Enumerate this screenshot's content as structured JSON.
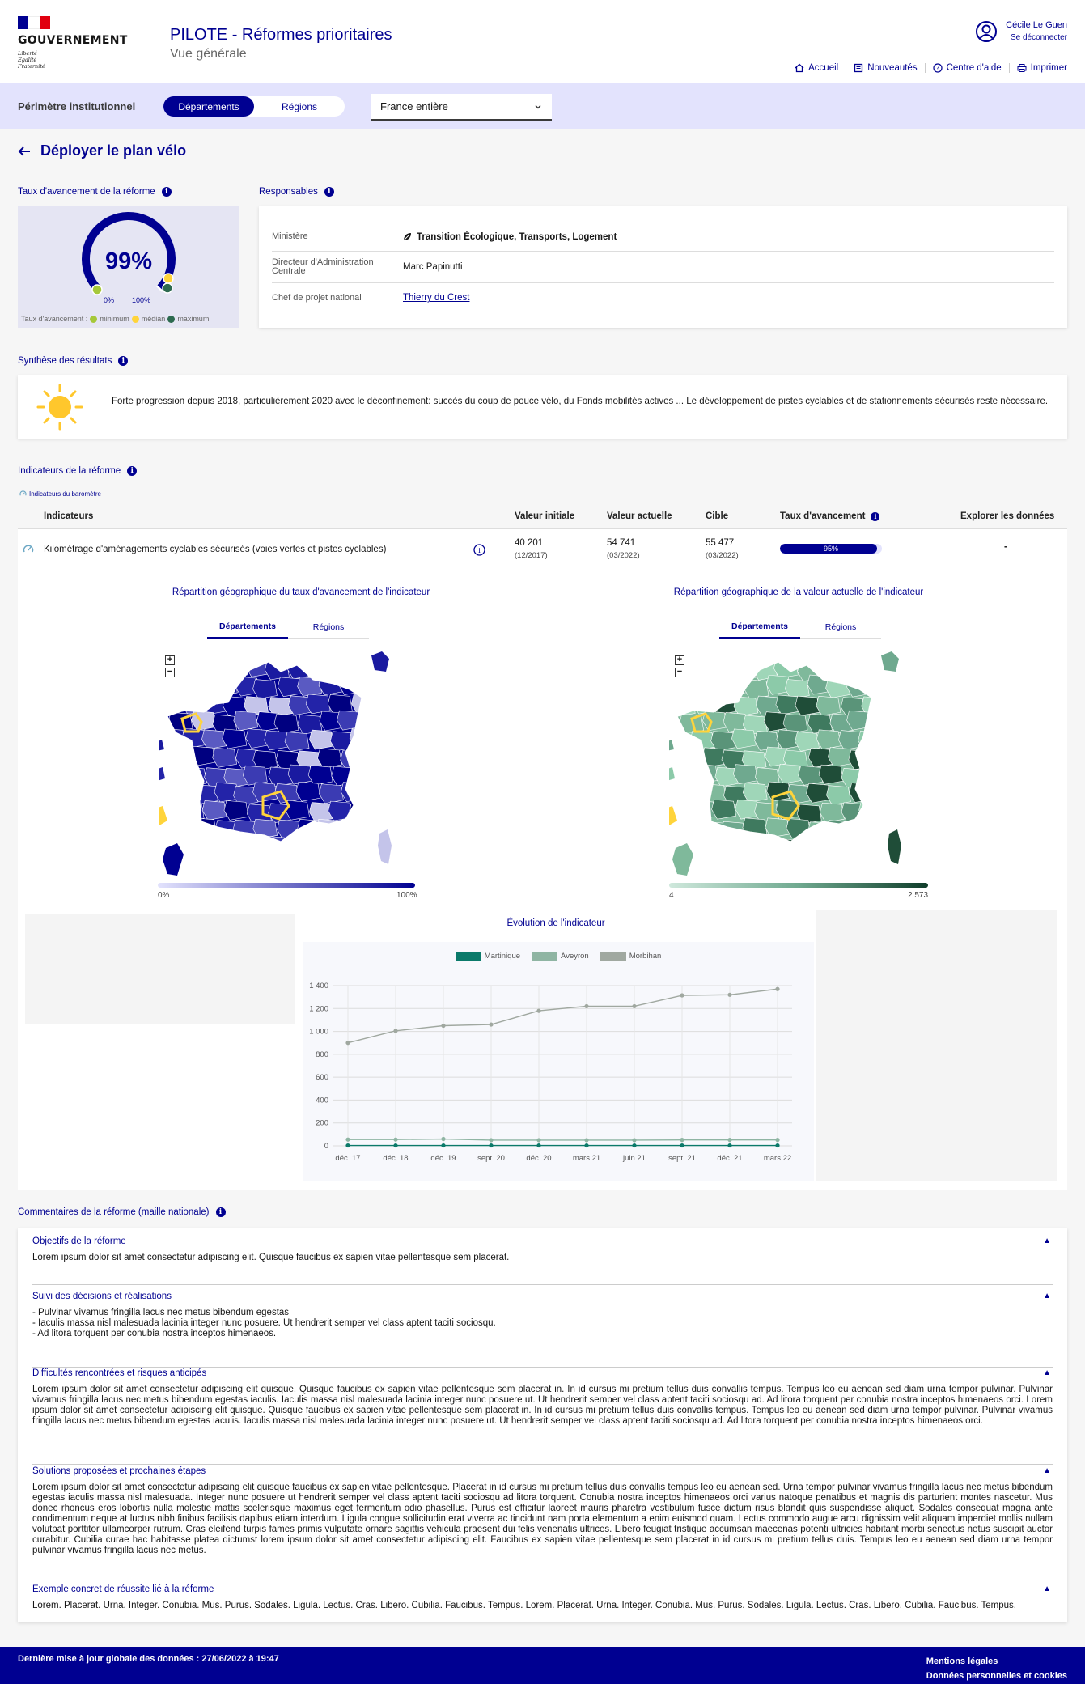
{
  "header": {
    "gov_line": "GOUVERNEMENT",
    "motto": [
      "Liberté",
      "Égalité",
      "Fraternité"
    ],
    "app_title": "PILOTE - Réformes prioritaires",
    "app_subtitle": "Vue générale",
    "user_name": "Cécile Le Guen",
    "logout_label": "Se déconnecter",
    "nav": [
      "Accueil",
      "Nouveautés",
      "Centre d'aide",
      "Imprimer"
    ]
  },
  "perimeter": {
    "label": "Périmètre institutionnel",
    "toggle": [
      "Départements",
      "Régions"
    ],
    "selected_area": "France entière"
  },
  "page_title": "Déployer le plan vélo",
  "progress": {
    "label": "Taux d'avancement de la réforme",
    "value_label": "99%",
    "value": 0.99,
    "min_label": "0%",
    "max_label": "100%",
    "legend_prefix": "Taux d'avancement :",
    "legend": [
      "minimum",
      "médian",
      "maximum"
    ]
  },
  "responsables": {
    "label": "Responsables",
    "rows": [
      {
        "key": "Ministère",
        "value": "Transition Écologique, Transports, Logement"
      },
      {
        "key": "Directeur d'Administration Centrale",
        "value": "Marc Papinutti"
      },
      {
        "key": "Chef de projet national",
        "value": "Thierry du Crest"
      }
    ]
  },
  "synthese": {
    "label": "Synthèse des résultats",
    "weather": "sun-icon",
    "text": "Forte progression depuis 2018, particulièrement 2020 avec le déconfinement: succès du coup de pouce vélo, du Fonds mobilités actives ... Le développement de pistes cyclables et de stationnements sécurisés reste nécessaire."
  },
  "indicators": {
    "label": "Indicateurs de la réforme",
    "barometer_legend": "Indicateurs du baromètre",
    "columns": [
      "Indicateurs",
      "Valeur initiale",
      "Valeur actuelle",
      "Cible",
      "Taux d'avancement",
      "Explorer les données"
    ],
    "row": {
      "name": "Kilométrage d'aménagements cyclables sécurisés (voies vertes et pistes cyclables)",
      "initial": "40 201",
      "initial_date": "(12/2017)",
      "current": "54 741",
      "current_date": "(03/2022)",
      "target": "55 477",
      "target_date": "(03/2022)",
      "progress_label": "95%",
      "progress": 0.95,
      "explore": "-"
    },
    "map_left": {
      "title": "Répartition géographique du taux d'avancement de l'indicateur",
      "tabs": [
        "Départements",
        "Régions"
      ],
      "scale_min": "0%",
      "scale_max": "100%",
      "color": "#000091"
    },
    "map_right": {
      "title": "Répartition géographique de la valeur actuelle de l'indicateur",
      "tabs": [
        "Départements",
        "Régions"
      ],
      "scale_min": "4",
      "scale_max": "2 573",
      "color": "#6fa98f"
    },
    "zoom_in": "+",
    "zoom_out": "−"
  },
  "chart_data": {
    "type": "line",
    "title": "Évolution de l'indicateur",
    "x": [
      "déc. 17",
      "déc. 18",
      "déc. 19",
      "sept. 20",
      "déc. 20",
      "mars 21",
      "juin 21",
      "sept. 21",
      "déc. 21",
      "mars 22"
    ],
    "yticks": [
      "0",
      "200",
      "400",
      "600",
      "800",
      "1 000",
      "1 200",
      "1 400"
    ],
    "ylim": [
      0,
      1400
    ],
    "series": [
      {
        "name": "Martinique",
        "color": "#0b7a6a",
        "values": [
          3,
          3,
          3,
          3,
          3,
          3,
          3,
          3,
          3,
          3
        ]
      },
      {
        "name": "Aveyron",
        "color": "#8fb5a3",
        "values": [
          55,
          55,
          60,
          50,
          50,
          50,
          50,
          52,
          52,
          52
        ]
      },
      {
        "name": "Morbihan",
        "color": "#a0a8a0",
        "values": [
          900,
          1005,
          1050,
          1060,
          1180,
          1220,
          1220,
          1315,
          1320,
          1370
        ]
      }
    ]
  },
  "comments": {
    "label": "Commentaires de la réforme (maille nationale)",
    "items": [
      {
        "title": "Objectifs de la réforme",
        "text": "Lorem ipsum dolor sit amet consectetur adipiscing elit. Quisque faucibus ex sapien vitae pellentesque sem placerat."
      },
      {
        "title": "Suivi des décisions et réalisations",
        "lines": [
          "- Pulvinar vivamus fringilla lacus nec metus bibendum egestas",
          "- Iaculis massa nisl malesuada lacinia integer nunc posuere. Ut hendrerit semper vel class aptent taciti sociosqu.",
          "- Ad litora torquent per conubia nostra inceptos himenaeos."
        ]
      },
      {
        "title": "Difficultés rencontrées et risques anticipés",
        "text": "Lorem ipsum dolor sit amet consectetur adipiscing elit quisque. Quisque faucibus ex sapien vitae pellentesque sem placerat in. In id cursus mi pretium tellus duis convallis tempus. Tempus leo eu aenean sed diam urna tempor pulvinar. Pulvinar vivamus fringilla lacus nec metus bibendum egestas iaculis. Iaculis massa nisl malesuada lacinia integer nunc posuere ut. Ut hendrerit semper vel class aptent taciti sociosqu ad. Ad litora torquent per conubia nostra inceptos himenaeos orci. Lorem ipsum dolor sit amet consectetur adipiscing elit quisque. Quisque faucibus ex sapien vitae pellentesque sem placerat in. In id cursus mi pretium tellus duis convallis tempus. Tempus leo eu aenean sed diam urna tempor pulvinar. Pulvinar vivamus fringilla lacus nec metus bibendum egestas iaculis. Iaculis massa nisl malesuada lacinia integer nunc posuere ut. Ut hendrerit semper vel class aptent taciti sociosqu ad. Ad litora torquent per conubia nostra inceptos himenaeos orci."
      },
      {
        "title": "Solutions proposées et prochaines étapes",
        "text": "Lorem ipsum dolor sit amet consectetur adipiscing elit quisque faucibus ex sapien vitae pellentesque. Placerat in id cursus mi pretium tellus duis convallis tempus leo eu aenean sed. Urna tempor pulvinar vivamus fringilla lacus nec metus bibendum egestas iaculis massa nisl malesuada. Integer nunc posuere ut hendrerit semper vel class aptent taciti sociosqu ad litora torquent. Conubia nostra inceptos himenaeos orci varius natoque penatibus et magnis dis parturient montes nascetur. Mus donec rhoncus eros lobortis nulla molestie mattis scelerisque maximus eget fermentum odio phasellus. Purus est efficitur laoreet mauris pharetra vestibulum fusce dictum risus blandit quis suspendisse aliquet. Sodales consequat magna ante condimentum neque at luctus nibh finibus facilisis dapibus etiam interdum. Ligula congue sollicitudin erat viverra ac tincidunt nam porta elementum a enim euismod quam. Lectus commodo augue arcu dignissim velit aliquam imperdiet mollis nullam volutpat porttitor ullamcorper rutrum. Cras eleifend turpis fames primis vulputate ornare sagittis vehicula praesent dui felis venenatis ultrices. Libero feugiat tristique accumsan maecenas potenti ultricies habitant morbi senectus netus suscipit auctor curabitur. Cubilia curae hac habitasse platea dictumst lorem ipsum dolor sit amet consectetur adipiscing elit. Faucibus ex sapien vitae pellentesque sem placerat in id cursus mi pretium tellus duis. Tempus leo eu aenean sed diam urna tempor pulvinar vivamus fringilla lacus nec metus."
      },
      {
        "title": "Exemple concret de réussite lié à la réforme",
        "text": "Lorem. Placerat. Urna. Integer. Conubia. Mus. Purus. Sodales. Ligula. Lectus. Cras. Libero. Cubilia. Faucibus. Tempus. Lorem. Placerat. Urna. Integer. Conubia. Mus. Purus. Sodales. Ligula. Lectus. Cras. Libero. Cubilia. Faucibus. Tempus."
      }
    ]
  },
  "footer": {
    "update_text": "Dernière mise à jour globale des données : 27/06/2022 à 19:47",
    "links": [
      "Mentions légales",
      "Données personnelles et cookies"
    ]
  },
  "colors": {
    "primary": "#000091",
    "yellow": "#ffd43b",
    "green_light": "#a6c83a",
    "green_dark": "#2d6a4f"
  }
}
